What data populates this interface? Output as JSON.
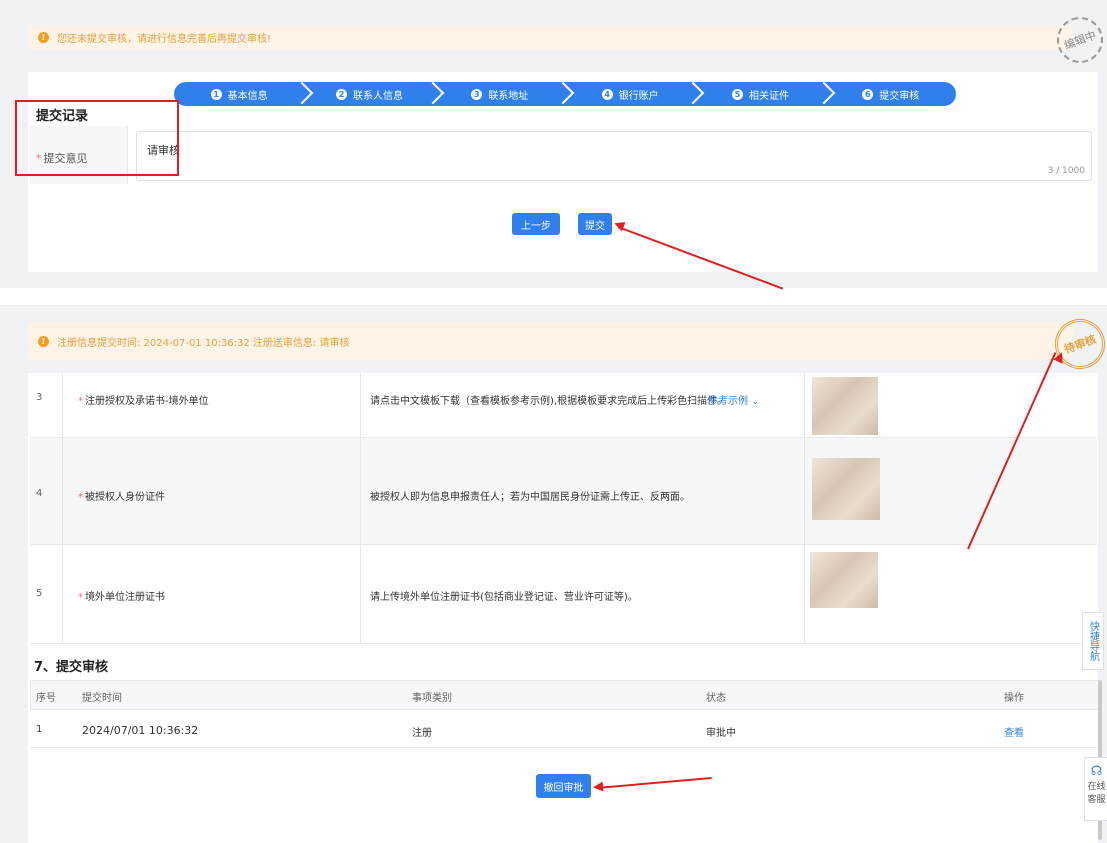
{
  "top": {
    "banner_text": "您还未提交审核，请进行信息完善后再提交审核!",
    "stamp_text": "编辑中",
    "steps": [
      {
        "num": "1",
        "label": "基本信息"
      },
      {
        "num": "2",
        "label": "联系人信息"
      },
      {
        "num": "3",
        "label": "联系地址"
      },
      {
        "num": "4",
        "label": "银行账户"
      },
      {
        "num": "5",
        "label": "相关证件"
      },
      {
        "num": "6",
        "label": "提交审核"
      }
    ],
    "section_title": "提交记录",
    "field_label": "提交意见",
    "field_value": "请审核",
    "char_count": "3 / 1000",
    "prev_button": "上一步",
    "submit_button": "提交"
  },
  "bottom": {
    "banner_text": "注册信息提交时间: 2024-07-01 10:36:32 注册送审信息: 请审核",
    "stamp_text": "待审核",
    "docs": [
      {
        "index": "3",
        "name": "注册授权及承诺书-境外单位",
        "desc": "请点击中文模板下载（查看模板参考示例),根据模板要求完成后上传彩色扫描件。",
        "example": "参考示例"
      },
      {
        "index": "4",
        "name": "被授权人身份证件",
        "desc": "被授权人即为信息申报责任人；若为中国居民身份证需上传正、反两面。",
        "example": ""
      },
      {
        "index": "5",
        "name": "境外单位注册证书",
        "desc": "请上传境外单位注册证书(包括商业登记证、营业许可证等)。",
        "example": ""
      }
    ],
    "section_title": "7、提交审核",
    "table_headers": [
      "序号",
      "提交时间",
      "事项类别",
      "状态",
      "操作"
    ],
    "table_rows": [
      {
        "index": "1",
        "time": "2024/07/01 10:36:32",
        "category": "注册",
        "status": "审批中",
        "action": "查看"
      }
    ],
    "withdraw_button": "撤回审批",
    "quick_nav": "快捷导航",
    "online_cs_1": "在线",
    "online_cs_2": "客服"
  },
  "colors": {
    "primary": "#2f80ed",
    "warning": "#e6a23c",
    "annotation": "#e02020"
  }
}
